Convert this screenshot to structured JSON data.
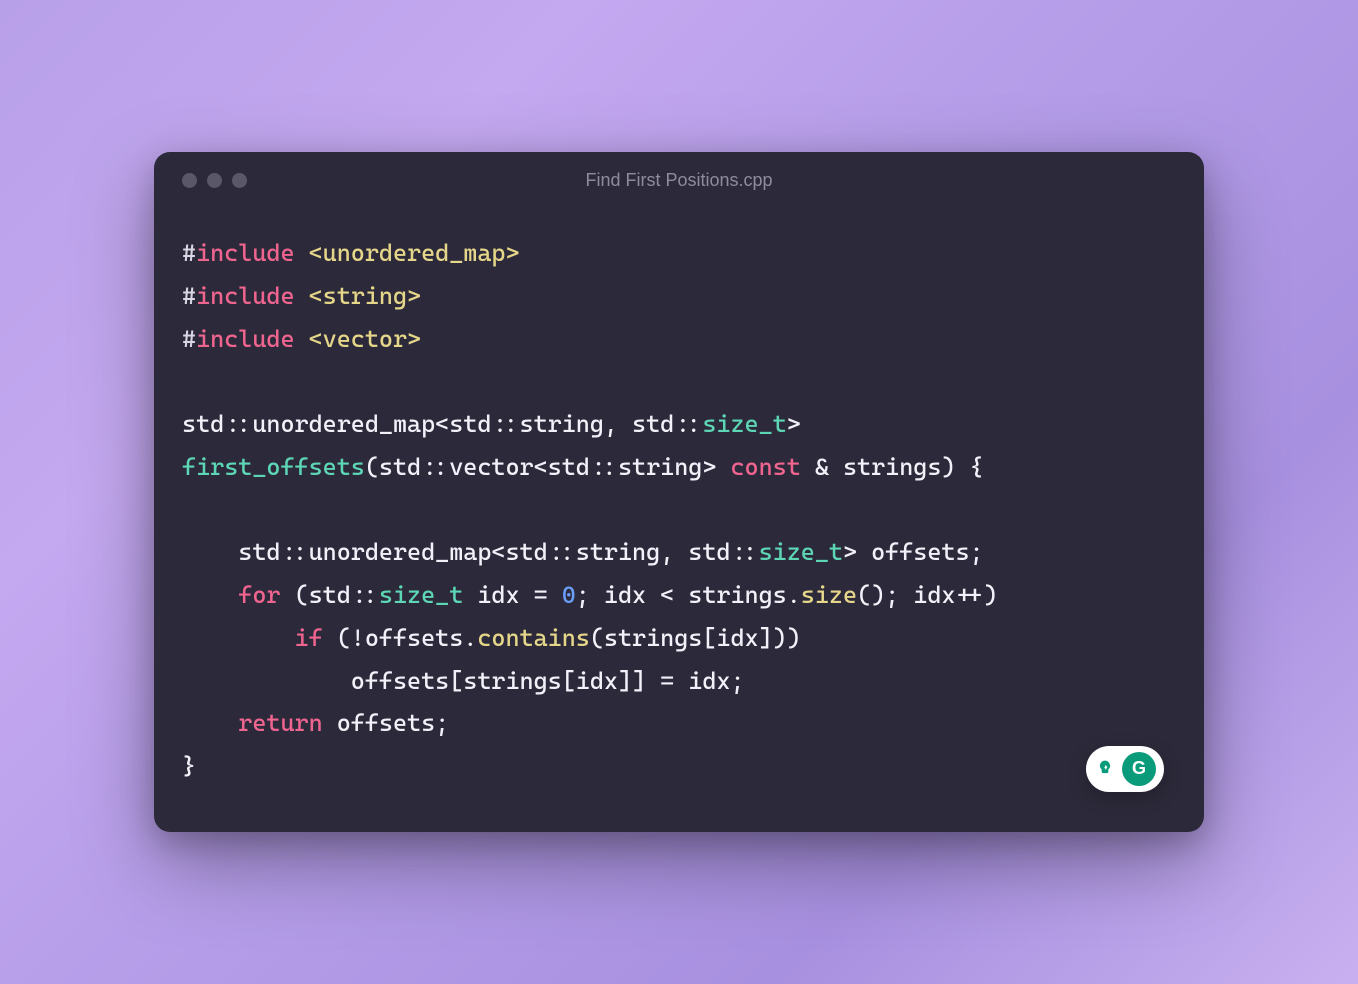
{
  "window": {
    "title": "Find First Positions.cpp"
  },
  "code": {
    "tokens": [
      [
        {
          "t": "#",
          "c": "tok-pre"
        },
        {
          "t": "include",
          "c": "tok-kw"
        },
        {
          "t": " ",
          "c": ""
        },
        {
          "t": "<unordered_map>",
          "c": "tok-str"
        }
      ],
      [
        {
          "t": "#",
          "c": "tok-pre"
        },
        {
          "t": "include",
          "c": "tok-kw"
        },
        {
          "t": " ",
          "c": ""
        },
        {
          "t": "<string>",
          "c": "tok-str"
        }
      ],
      [
        {
          "t": "#",
          "c": "tok-pre"
        },
        {
          "t": "include",
          "c": "tok-kw"
        },
        {
          "t": " ",
          "c": ""
        },
        {
          "t": "<vector>",
          "c": "tok-str"
        }
      ],
      [],
      [
        {
          "t": "std::unordered_map<std::string, std::",
          "c": ""
        },
        {
          "t": "size_t",
          "c": "tok-type"
        },
        {
          "t": ">",
          "c": ""
        }
      ],
      [
        {
          "t": "first_offsets",
          "c": "tok-type"
        },
        {
          "t": "(std::vector<std::string> ",
          "c": ""
        },
        {
          "t": "const",
          "c": "tok-kw"
        },
        {
          "t": " & strings) {",
          "c": ""
        }
      ],
      [],
      [
        {
          "t": "    std::unordered_map<std::string, std::",
          "c": ""
        },
        {
          "t": "size_t",
          "c": "tok-type"
        },
        {
          "t": "> offsets;",
          "c": ""
        }
      ],
      [
        {
          "t": "    ",
          "c": ""
        },
        {
          "t": "for",
          "c": "tok-kw"
        },
        {
          "t": " (std::",
          "c": ""
        },
        {
          "t": "size_t",
          "c": "tok-type"
        },
        {
          "t": " idx = ",
          "c": ""
        },
        {
          "t": "0",
          "c": "tok-num"
        },
        {
          "t": "; idx < strings.",
          "c": ""
        },
        {
          "t": "size",
          "c": "tok-fn"
        },
        {
          "t": "(); idx++)",
          "c": ""
        }
      ],
      [
        {
          "t": "        ",
          "c": ""
        },
        {
          "t": "if",
          "c": "tok-kw"
        },
        {
          "t": " (!offsets.",
          "c": ""
        },
        {
          "t": "contains",
          "c": "tok-fn"
        },
        {
          "t": "(strings[idx]))",
          "c": ""
        }
      ],
      [
        {
          "t": "            offsets[strings[idx]] = idx;",
          "c": ""
        }
      ],
      [
        {
          "t": "    ",
          "c": ""
        },
        {
          "t": "return",
          "c": "tok-kw"
        },
        {
          "t": " offsets;",
          "c": ""
        }
      ],
      [
        {
          "t": "}",
          "c": ""
        }
      ]
    ]
  },
  "widget": {
    "letter": "G"
  }
}
